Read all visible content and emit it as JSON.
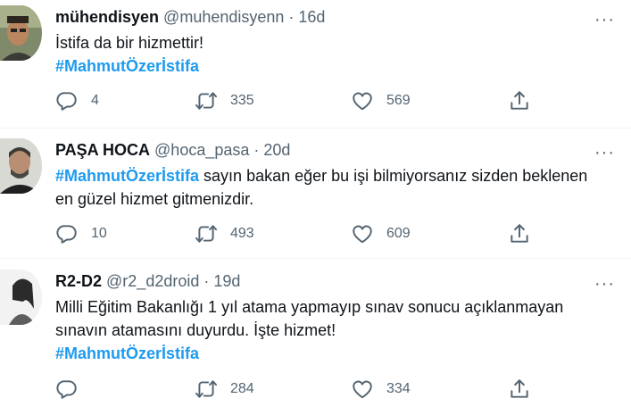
{
  "tweets": [
    {
      "name": "mühendisyen",
      "handle": "@muhendisyenn",
      "time": "16d",
      "more": "···",
      "text_before": "",
      "text_lines": [
        "İstifa da bir hizmettir!"
      ],
      "hashtag_after": "#MahmutÖzerİstifa",
      "replies": "4",
      "retweets": "335",
      "likes": "569"
    },
    {
      "name": "PAŞA HOCA",
      "handle": "@hoca_pasa",
      "time": "20d",
      "more": "···",
      "hashtag_before": "#MahmutÖzerİstifa",
      "text_lines": [
        " sayın bakan eğer bu işi bilmiyorsanız sizden beklenen",
        "en güzel hizmet gitmenizdir."
      ],
      "replies": "10",
      "retweets": "493",
      "likes": "609"
    },
    {
      "name": "R2-D2",
      "handle": "@r2_d2droid",
      "time": "19d",
      "more": "···",
      "text_lines": [
        "Milli Eğitim Bakanlığı 1 yıl atama yapmayıp sınav sonucu açıklanmayan",
        "sınavın atamasını duyurdu. İşte hizmet!"
      ],
      "hashtag_after": "#MahmutÖzerİstifa",
      "replies": "",
      "retweets": "284",
      "likes": "334"
    }
  ],
  "separator": " · ",
  "colors": {
    "accent": "#1d9bf0",
    "muted": "#536471",
    "text": "#0f1419",
    "divider": "#eff3f4"
  },
  "icons": [
    "reply-icon",
    "retweet-icon",
    "like-icon",
    "share-icon",
    "more-icon"
  ]
}
